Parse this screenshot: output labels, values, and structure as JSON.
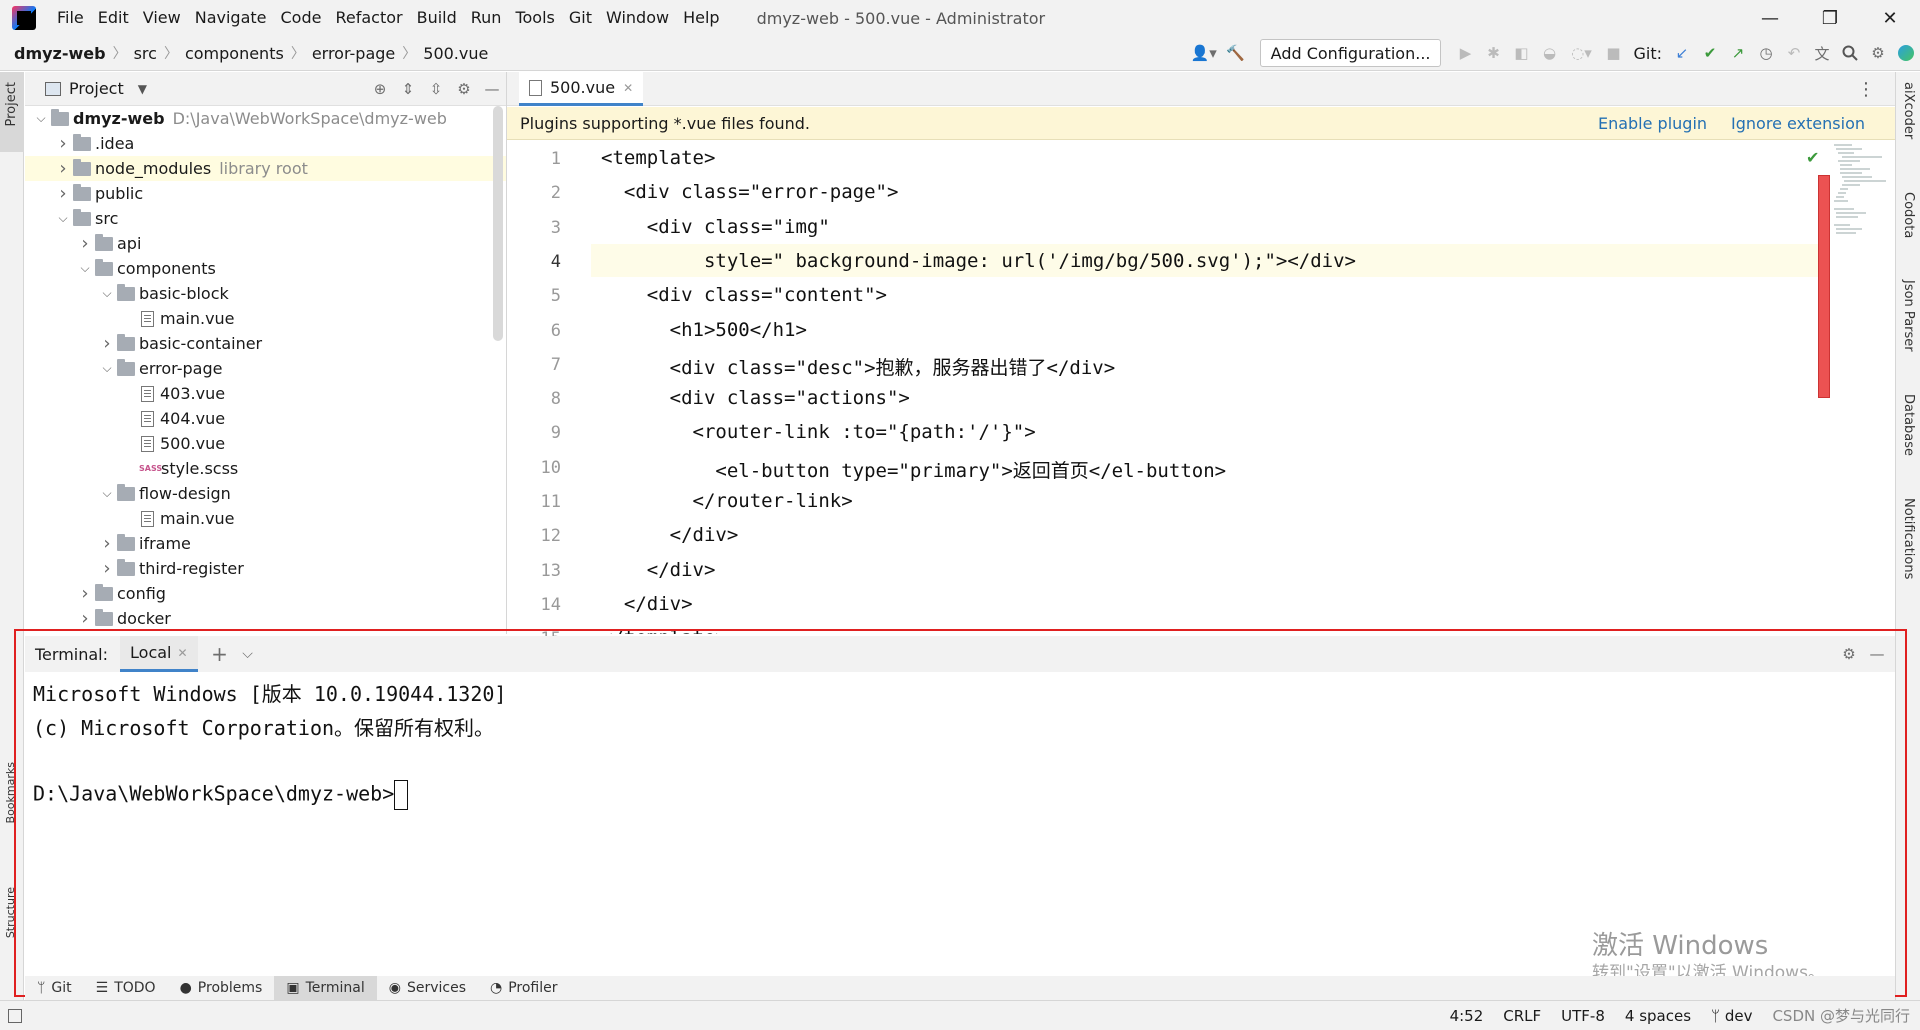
{
  "menubar": {
    "items": [
      "File",
      "Edit",
      "View",
      "Navigate",
      "Code",
      "Refactor",
      "Build",
      "Run",
      "Tools",
      "Git",
      "Window",
      "Help"
    ],
    "window_title": "dmyz-web - 500.vue - Administrator"
  },
  "navbar": {
    "crumbs": [
      "dmyz-web",
      "src",
      "components",
      "error-page",
      "500.vue"
    ],
    "add_config": "Add Configuration...",
    "git_label": "Git:"
  },
  "left_strip": {
    "project": "Project",
    "bookmarks": "Bookmarks",
    "structure": "Structure"
  },
  "right_strip": {
    "aixcoder": "aiXcoder",
    "codota": "Codota",
    "json_parser": "Json Parser",
    "database": "Database",
    "notifications": "Notifications"
  },
  "project": {
    "title": "Project",
    "tree": [
      {
        "label": "dmyz-web",
        "hint": "D:\\Java\\WebWorkSpace\\dmyz-web",
        "kind": "folder",
        "depth": 0,
        "open": true,
        "bold": true
      },
      {
        "label": ".idea",
        "kind": "folder",
        "depth": 1,
        "open": false
      },
      {
        "label": "node_modules",
        "hint": "library root",
        "kind": "folder",
        "depth": 1,
        "open": false,
        "sel": true
      },
      {
        "label": "public",
        "kind": "folder",
        "depth": 1,
        "open": false
      },
      {
        "label": "src",
        "kind": "folder",
        "depth": 1,
        "open": true
      },
      {
        "label": "api",
        "kind": "folder",
        "depth": 2,
        "open": false
      },
      {
        "label": "components",
        "kind": "folder",
        "depth": 2,
        "open": true
      },
      {
        "label": "basic-block",
        "kind": "folder",
        "depth": 3,
        "open": true
      },
      {
        "label": "main.vue",
        "kind": "file",
        "depth": 4
      },
      {
        "label": "basic-container",
        "kind": "folder",
        "depth": 3,
        "open": false
      },
      {
        "label": "error-page",
        "kind": "folder",
        "depth": 3,
        "open": true
      },
      {
        "label": "403.vue",
        "kind": "file",
        "depth": 4
      },
      {
        "label": "404.vue",
        "kind": "file",
        "depth": 4
      },
      {
        "label": "500.vue",
        "kind": "file",
        "depth": 4
      },
      {
        "label": "style.scss",
        "kind": "sass",
        "depth": 4
      },
      {
        "label": "flow-design",
        "kind": "folder",
        "depth": 3,
        "open": true
      },
      {
        "label": "main.vue",
        "kind": "file",
        "depth": 4
      },
      {
        "label": "iframe",
        "kind": "folder",
        "depth": 3,
        "open": false
      },
      {
        "label": "third-register",
        "kind": "folder",
        "depth": 3,
        "open": false
      },
      {
        "label": "config",
        "kind": "folder",
        "depth": 2,
        "open": false
      },
      {
        "label": "docker",
        "kind": "folder",
        "depth": 2,
        "open": false
      }
    ]
  },
  "editor": {
    "tab": "500.vue",
    "plugin_msg": "Plugins supporting *.vue files found.",
    "enable_plugin": "Enable plugin",
    "ignore_extension": "Ignore extension",
    "lines": [
      "<template>",
      "  <div class=\"error-page\">",
      "    <div class=\"img\"",
      "         style=\" background-image: url('/img/bg/500.svg');\"></div>",
      "    <div class=\"content\">",
      "      <h1>500</h1>",
      "      <div class=\"desc\">抱歉，服务器出错了</div>",
      "      <div class=\"actions\">",
      "        <router-link :to=\"{path:'/'}\">",
      "          <el-button type=\"primary\">返回首页</el-button>",
      "        </router-link>",
      "      </div>",
      "    </div>",
      "  </div>",
      "</template>"
    ]
  },
  "terminal": {
    "label": "Terminal:",
    "tab": "Local",
    "lines": [
      "Microsoft Windows [版本 10.0.19044.1320]",
      "(c) Microsoft Corporation。保留所有权利。",
      "",
      "D:\\Java\\WebWorkSpace\\dmyz-web>"
    ]
  },
  "bottom_tabs": [
    "Git",
    "TODO",
    "Problems",
    "Terminal",
    "Services",
    "Profiler"
  ],
  "watermark": {
    "line1": "激活 Windows",
    "line2": "转到\"设置\"以激活 Windows。"
  },
  "status": {
    "position": "4:52",
    "line_sep": "CRLF",
    "encoding": "UTF-8",
    "indent": "4 spaces",
    "branch": "dev",
    "csdn": "CSDN @梦与光同行"
  }
}
